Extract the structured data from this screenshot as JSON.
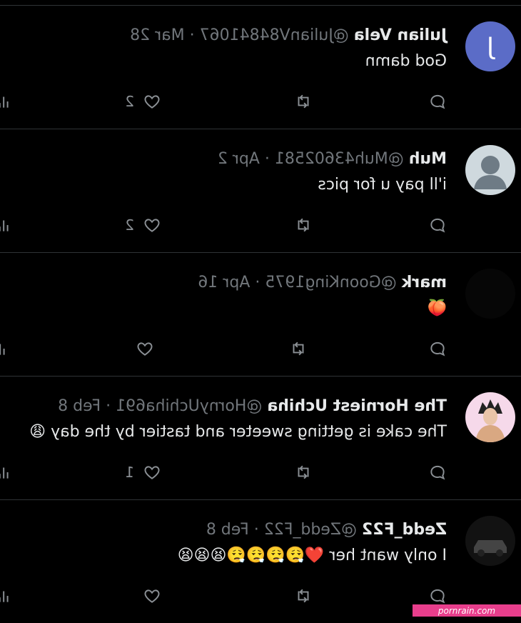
{
  "tweets": [
    {
      "name": "Julian Vela",
      "handle": "@JulianV8484106​7",
      "separator": "·",
      "date": "Mar 28",
      "text": "God damn",
      "avatar_letter": "J",
      "reply_count": "",
      "like_count": "2"
    },
    {
      "name": "Muh",
      "handle": "@Muh43602581",
      "separator": "·",
      "date": "Apr 2",
      "text": "i'll pay u for pics",
      "avatar_letter": "",
      "reply_count": "",
      "like_count": "2"
    },
    {
      "name": "mark",
      "handle": "@GoonKing1975",
      "separator": "·",
      "date": "Apr 16",
      "text": "🍑",
      "avatar_letter": "",
      "reply_count": "",
      "like_count": ""
    },
    {
      "name": "The Horniest Uchiha",
      "handle": "@HornyUchiha691",
      "separator": "·",
      "date": "Feb 8",
      "text": "The cake is getting sweeter and tastier by the day 😩",
      "avatar_letter": "",
      "reply_count": "",
      "like_count": "1"
    },
    {
      "name": "Zedd_F22",
      "handle": "@Zedd_F22",
      "separator": "·",
      "date": "Feb 8",
      "text": "I only want her ❤️😮‍💨😮‍💨😮‍💨😮‍💨😫😫😫",
      "avatar_letter": "",
      "reply_count": "",
      "like_count": ""
    }
  ],
  "watermark": "pornrain.com",
  "colors": {
    "background": "#000000",
    "text": "#e7e9ea",
    "muted": "#71767b",
    "divider": "#2f3336",
    "avatar_blue": "#5b6cc7",
    "watermark_pink": "#e83e8c"
  }
}
